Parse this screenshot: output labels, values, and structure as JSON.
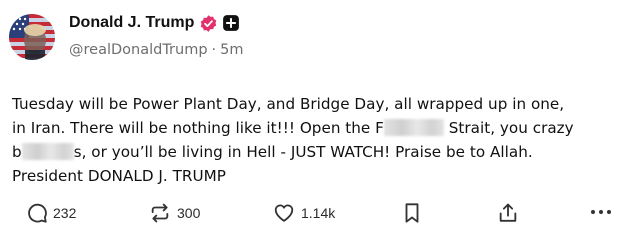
{
  "author": {
    "display_name": "Donald J. Trump",
    "handle": "@realDonaldTrump",
    "separator": "·",
    "time_ago": "5m"
  },
  "post": {
    "line1": "Tuesday will be Power Plant Day, and Bridge Day, all wrapped up in one,",
    "line2_pre": "in Iran. There will be nothing like it!!! Open the F",
    "line2_post": "Strait, you crazy",
    "line3_pre": "b",
    "line3_post": "s, or you’ll be living in Hell - JUST WATCH! Praise be to Allah.",
    "line4": "President DONALD J. TRUMP"
  },
  "actions": {
    "replies": "232",
    "reposts": "300",
    "likes": "1.14k"
  },
  "colors": {
    "verified_badge": "#e1306c",
    "text": "#111111",
    "muted": "#6e6e6e",
    "icon": "#333333"
  },
  "icons": {
    "verified": "verified-badge-icon",
    "follow": "plus-square-icon",
    "reply": "speech-bubble-icon",
    "repost": "repost-arrows-icon",
    "like": "heart-icon",
    "bookmark": "bookmark-icon",
    "share": "share-upload-icon",
    "more": "ellipsis-icon"
  }
}
